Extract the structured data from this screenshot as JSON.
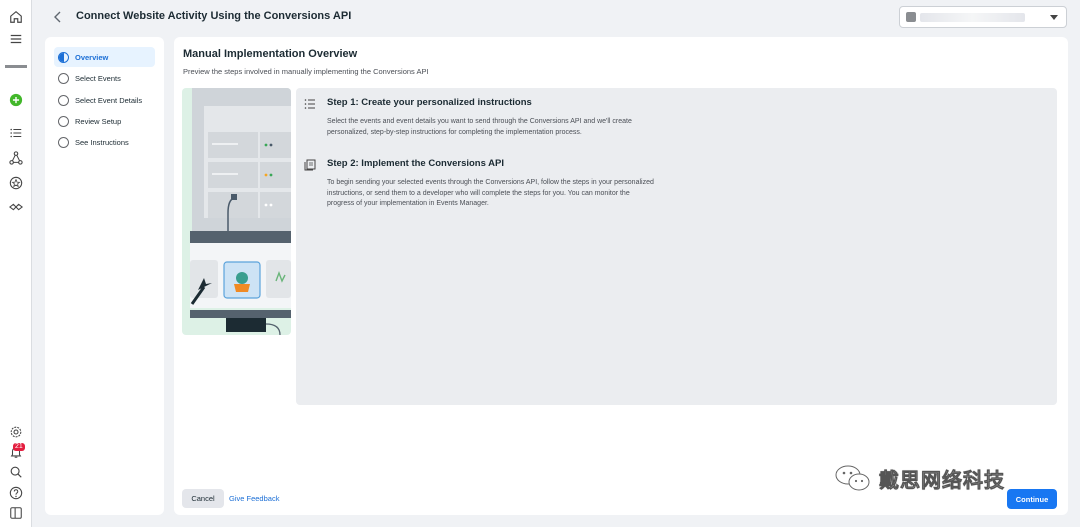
{
  "header": {
    "title": "Connect Website Activity Using the Conversions API",
    "account_name": ""
  },
  "steps": [
    {
      "label": "Overview",
      "active": true
    },
    {
      "label": "Select Events",
      "active": false
    },
    {
      "label": "Select Event Details",
      "active": false
    },
    {
      "label": "Review Setup",
      "active": false
    },
    {
      "label": "See Instructions",
      "active": false
    }
  ],
  "main": {
    "title": "Manual Implementation Overview",
    "subtitle": "Preview the steps involved in manually implementing the Conversions API",
    "instructions": [
      {
        "icon": "list-icon",
        "heading": "Step 1: Create your personalized instructions",
        "body": "Select the events and event details you want to send through the Conversions API and we'll create personalized, step-by-step instructions for completing the implementation process."
      },
      {
        "icon": "documents-icon",
        "heading": "Step 2: Implement the Conversions API",
        "body": "To begin sending your selected events through the Conversions API, follow the steps in your personalized instructions, or send them to a developer who will complete the steps for you. You can monitor the progress of your implementation in Events Manager."
      }
    ]
  },
  "footer": {
    "cancel_label": "Cancel",
    "feedback_label": "Give Feedback",
    "continue_label": "Continue"
  },
  "notifications": {
    "count": "21"
  },
  "watermark": {
    "text": "戴思网络科技"
  },
  "colors": {
    "accent": "#1877f2",
    "active_step": "#1c6fd6",
    "active_step_bg": "#e7f3ff",
    "illustration_bg": "#ddf1e6",
    "instructions_bg": "#ebedf0",
    "page_bg": "#f0f2f5"
  }
}
